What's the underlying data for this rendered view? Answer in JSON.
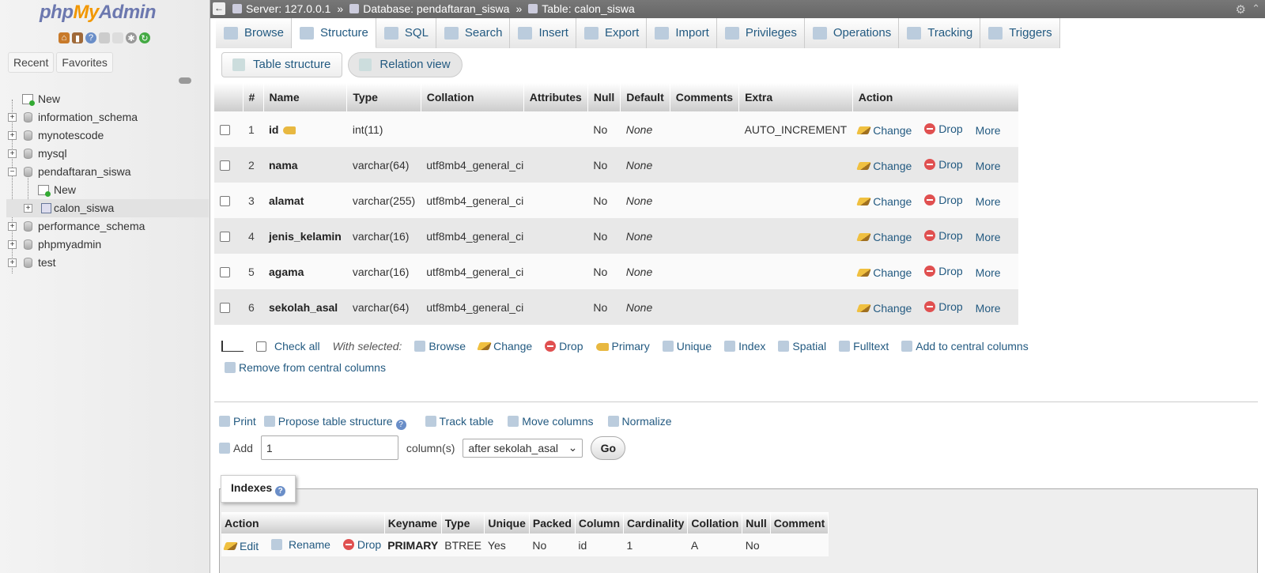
{
  "sidebar": {
    "logo_php": "php",
    "logo_my": "My",
    "logo_admin": "Admin",
    "tabs": [
      "Recent",
      "Favorites"
    ],
    "tree": [
      {
        "label": "New",
        "kind": "new"
      },
      {
        "label": "information_schema",
        "kind": "db"
      },
      {
        "label": "mynotescode",
        "kind": "db"
      },
      {
        "label": "mysql",
        "kind": "db"
      },
      {
        "label": "pendaftaran_siswa",
        "kind": "db-open"
      },
      {
        "label": "New",
        "kind": "child-new"
      },
      {
        "label": "calon_siswa",
        "kind": "child-table"
      },
      {
        "label": "performance_schema",
        "kind": "db"
      },
      {
        "label": "phpmyadmin",
        "kind": "db"
      },
      {
        "label": "test",
        "kind": "db"
      }
    ]
  },
  "topbar": {
    "server": "Server: 127.0.0.1",
    "database": "Database: pendaftaran_siswa",
    "table": "Table: calon_siswa",
    "sep": "»"
  },
  "tabs": [
    "Browse",
    "Structure",
    "SQL",
    "Search",
    "Insert",
    "Export",
    "Import",
    "Privileges",
    "Operations",
    "Tracking",
    "Triggers"
  ],
  "active_tab": "Structure",
  "subtabs": [
    "Table structure",
    "Relation view"
  ],
  "structure": {
    "headers": [
      "#",
      "Name",
      "Type",
      "Collation",
      "Attributes",
      "Null",
      "Default",
      "Comments",
      "Extra",
      "Action"
    ],
    "rows": [
      {
        "num": "1",
        "name": "id",
        "type": "int(11)",
        "collation": "",
        "attributes": "",
        "null": "No",
        "default": "None",
        "comments": "",
        "extra": "AUTO_INCREMENT",
        "primary": true
      },
      {
        "num": "2",
        "name": "nama",
        "type": "varchar(64)",
        "collation": "utf8mb4_general_ci",
        "attributes": "",
        "null": "No",
        "default": "None",
        "comments": "",
        "extra": ""
      },
      {
        "num": "3",
        "name": "alamat",
        "type": "varchar(255)",
        "collation": "utf8mb4_general_ci",
        "attributes": "",
        "null": "No",
        "default": "None",
        "comments": "",
        "extra": ""
      },
      {
        "num": "4",
        "name": "jenis_kelamin",
        "type": "varchar(16)",
        "collation": "utf8mb4_general_ci",
        "attributes": "",
        "null": "No",
        "default": "None",
        "comments": "",
        "extra": ""
      },
      {
        "num": "5",
        "name": "agama",
        "type": "varchar(16)",
        "collation": "utf8mb4_general_ci",
        "attributes": "",
        "null": "No",
        "default": "None",
        "comments": "",
        "extra": ""
      },
      {
        "num": "6",
        "name": "sekolah_asal",
        "type": "varchar(64)",
        "collation": "utf8mb4_general_ci",
        "attributes": "",
        "null": "No",
        "default": "None",
        "comments": "",
        "extra": ""
      }
    ],
    "actions": {
      "change": "Change",
      "drop": "Drop",
      "more": "More"
    }
  },
  "with_selected": {
    "check_all": "Check all",
    "label": "With selected:",
    "actions": [
      "Browse",
      "Change",
      "Drop",
      "Primary",
      "Unique",
      "Index",
      "Spatial",
      "Fulltext",
      "Add to central columns"
    ],
    "remove_central": "Remove from central columns"
  },
  "tools": {
    "print": "Print",
    "propose": "Propose table structure",
    "track": "Track table",
    "move": "Move columns",
    "normalize": "Normalize"
  },
  "add_columns": {
    "label": "Add",
    "value": "1",
    "unit": "column(s)",
    "position": "after sekolah_asal",
    "go": "Go"
  },
  "indexes": {
    "legend": "Indexes",
    "headers": [
      "Action",
      "Keyname",
      "Type",
      "Unique",
      "Packed",
      "Column",
      "Cardinality",
      "Collation",
      "Null",
      "Comment"
    ],
    "actions": {
      "edit": "Edit",
      "rename": "Rename",
      "drop": "Drop"
    },
    "rows": [
      {
        "keyname": "PRIMARY",
        "type": "BTREE",
        "unique": "Yes",
        "packed": "No",
        "column": "id",
        "cardinality": "1",
        "collation": "A",
        "null": "No",
        "comment": ""
      }
    ]
  }
}
